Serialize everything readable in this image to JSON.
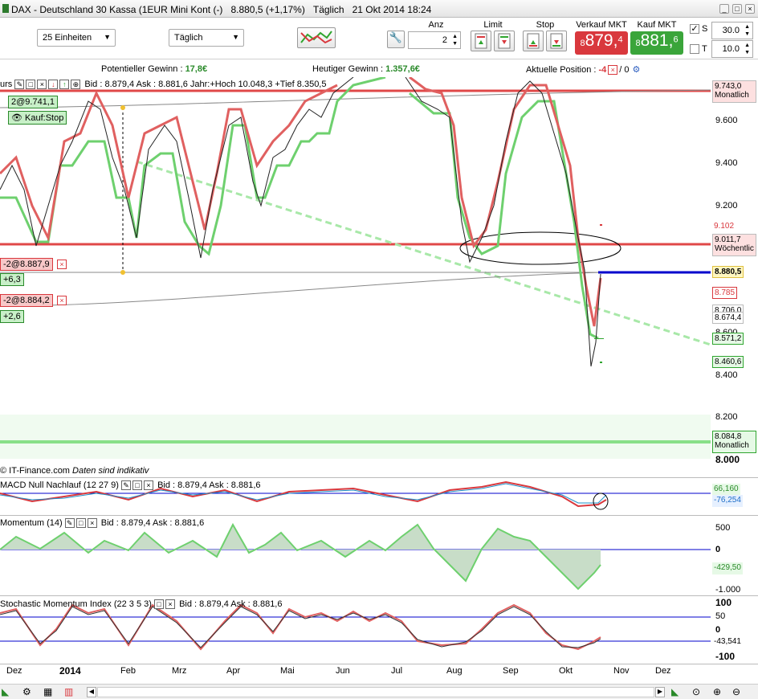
{
  "window": {
    "title": "DAX - Deutschland 30 Kassa (1EUR Mini Kont (-)",
    "price": "8.880,5 (+1,17%)",
    "period": "Täglich",
    "datetime": "21 Okt 2014 18:24"
  },
  "toolbar": {
    "units_select": "25 Einheiten",
    "interval_select": "Täglich",
    "anz_label": "Anz",
    "anz_value": "2",
    "limit_label": "Limit",
    "stop_label": "Stop",
    "sell_label": "Verkauf MKT",
    "sell_price_small": "8",
    "sell_price_big": "879,",
    "sell_price_sup": "4",
    "buy_label": "Kauf MKT",
    "buy_price_small": "8",
    "buy_price_big": "881,",
    "buy_price_sup": "6",
    "s_label": "S",
    "s_value": "30.0",
    "t_label": "T",
    "t_value": "10.0"
  },
  "infobar": {
    "pot_label": "Potentieller Gewinn : ",
    "pot_value": "17,8€",
    "today_label": "Heutiger Gewinn : ",
    "today_value": "1.357,6€",
    "pos_label": "Aktuelle Position : ",
    "pos_value": "-4",
    "pos_sep": "/ 0"
  },
  "main_pane": {
    "header_name": "urs",
    "header_quote": "Bid : 8.879,4 Ask : 8.881,6 Jahr:+Hoch 10.048,3 +Tief 8.350,5",
    "order1": "2@9.741,1",
    "order2": "Kauf:Stop",
    "order3": "-2@8.887,9",
    "order4": "+6,3",
    "order5": "-2@8.884,2",
    "order6": "+2,6",
    "copyright": "IT-Finance.com",
    "copyright_note": "Daten sind indikativ",
    "y_ticks": [
      "9.600",
      "9.400",
      "9.200",
      "8.600",
      "8.400",
      "8.200"
    ],
    "y_tick_bold": "8.000",
    "labels": {
      "monthly_value": "9.743,0",
      "monthly_label": "Monatlich",
      "r9102": "9.102",
      "weekly_value": "9.011,7",
      "weekly_label": "Wöchentlic",
      "current": "8.880,5",
      "l8785": "8.785",
      "l8706": "8.706,0",
      "l8674": "8.674,4",
      "l8571": "8.571,2",
      "l8460": "8.460,6",
      "bottom_value": "8.084,8",
      "bottom_label": "Monatlich"
    }
  },
  "macd_pane": {
    "name": "MACD Null Nachlauf (12 27 9)",
    "quote": "Bid : 8.879,4 Ask : 8.881,6",
    "v1": "66,160",
    "v2": "-76,254"
  },
  "momentum_pane": {
    "name": "Momentum (14)",
    "quote": "Bid : 8.879,4 Ask : 8.881,6",
    "t500": "500",
    "t0": "0",
    "val": "-429,50",
    "tm1000": "-1.000"
  },
  "stoch_pane": {
    "name": "Stochastic Momentum Index (22 3 5 3)",
    "quote": "Bid : 8.879,4 Ask : 8.881,6",
    "t100": "100",
    "t50": "50",
    "t0": "0",
    "val": "-43,541",
    "tm100": "-100"
  },
  "x_axis": [
    "Dez",
    "2014",
    "Feb",
    "Mrz",
    "Apr",
    "Mai",
    "Jun",
    "Jul",
    "Aug",
    "Sep",
    "Okt",
    "Nov",
    "Dez"
  ],
  "colors": {
    "up": "#2fa52f",
    "down": "#d9383d",
    "lightgreen": "#6ed06e",
    "pink": "#e06060",
    "blue": "#0000cc"
  }
}
